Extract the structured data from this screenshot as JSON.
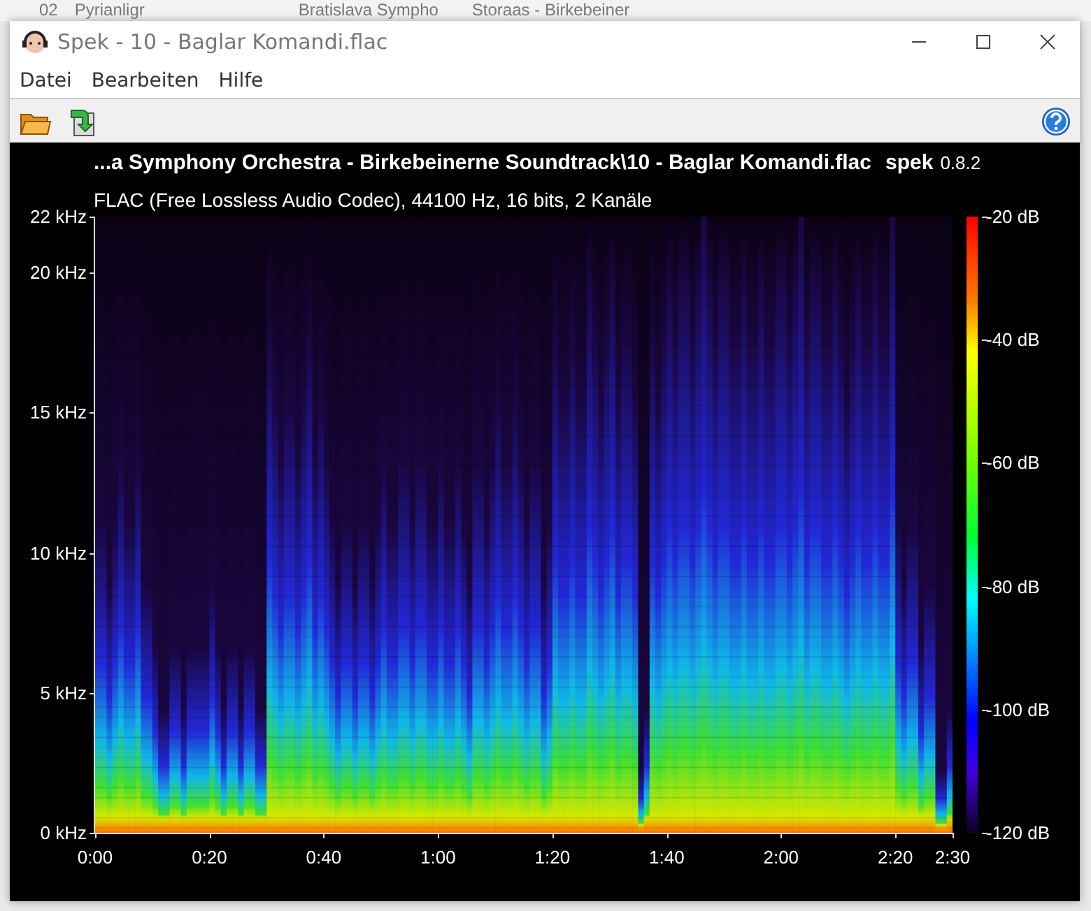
{
  "background_texts": [
    "02",
    "Pyrianligr",
    "Bratislava Sympho",
    "Storaas - Birkebeiner"
  ],
  "window": {
    "title": "Spek - 10 - Baglar Komandi.flac"
  },
  "menu": [
    "Datei",
    "Bearbeiten",
    "Hilfe"
  ],
  "header": {
    "file": "...a Symphony Orchestra - Birkebeinerne Soundtrack\\10 - Baglar Komandi.flac",
    "app_name": "spek",
    "version": "0.8.2",
    "info": "FLAC (Free Lossless Audio Codec), 44100 Hz, 16 bits, 2 Kanäle"
  },
  "frequency_labels": [
    "22 kHz",
    "20 kHz",
    "15 kHz",
    "10 kHz",
    "5 kHz",
    "0 kHz"
  ],
  "time_labels": [
    "0:00",
    "0:20",
    "0:40",
    "1:00",
    "1:20",
    "1:40",
    "2:00",
    "2:20",
    "2:30"
  ],
  "db_labels": [
    "-20 dB",
    "-40 dB",
    "-60 dB",
    "-80 dB",
    "-100 dB",
    "-120 dB"
  ]
}
